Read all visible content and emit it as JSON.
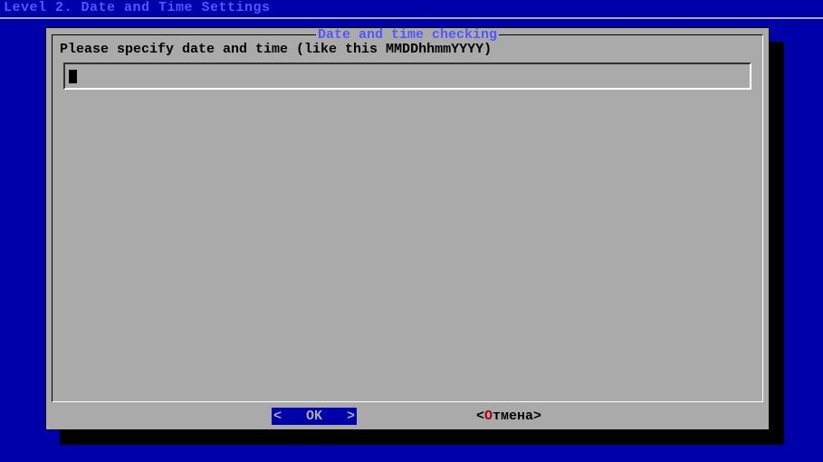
{
  "header": {
    "title": "Level 2. Date and Time Settings"
  },
  "dialog": {
    "title": "Date and time checking",
    "prompt": "Please specify date and time (like this MMDDhhmmYYYY)",
    "input_value": ""
  },
  "buttons": {
    "ok_full": "<   OK   >",
    "cancel_prefix": "<",
    "cancel_hotkey": "О",
    "cancel_rest": "тмена>"
  }
}
